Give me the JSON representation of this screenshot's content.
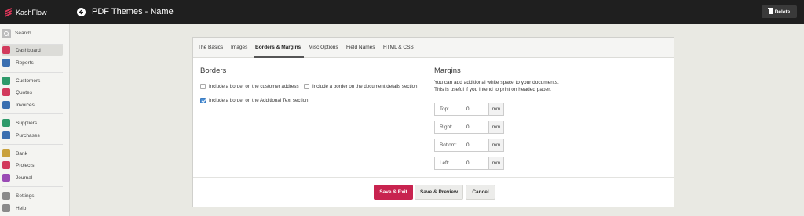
{
  "app": {
    "name": "KashFlow"
  },
  "header": {
    "title": "PDF Themes - Name",
    "delete_label": "Delete"
  },
  "sidebar": {
    "search_placeholder": "Search...",
    "items": [
      {
        "label": "Dashboard",
        "icon": "dashboard-icon",
        "color": "#d23a5c"
      },
      {
        "label": "Reports",
        "icon": "reports-icon",
        "color": "#3a6fb0"
      },
      {
        "label": "Customers",
        "icon": "customers-icon",
        "color": "#2e9a6a"
      },
      {
        "label": "Quotes",
        "icon": "quotes-icon",
        "color": "#d23a5c"
      },
      {
        "label": "Invoices",
        "icon": "invoices-icon",
        "color": "#3a6fb0"
      },
      {
        "label": "Suppliers",
        "icon": "suppliers-icon",
        "color": "#2e9a6a"
      },
      {
        "label": "Purchases",
        "icon": "purchases-icon",
        "color": "#3a6fb0"
      },
      {
        "label": "Bank",
        "icon": "bank-icon",
        "color": "#c9a13c"
      },
      {
        "label": "Projects",
        "icon": "projects-icon",
        "color": "#d23a5c"
      },
      {
        "label": "Journal",
        "icon": "journal-icon",
        "color": "#9a4bb5"
      },
      {
        "label": "Settings",
        "icon": "settings-icon",
        "color": "#8a8a8a"
      },
      {
        "label": "Help",
        "icon": "help-icon",
        "color": "#8a8a8a"
      }
    ]
  },
  "tabs": [
    "The Basics",
    "Images",
    "Borders & Margins",
    "Misc Options",
    "Field Names",
    "HTML & CSS"
  ],
  "borders": {
    "heading": "Borders",
    "opt_customer": "Include a border on the customer address",
    "opt_document": "Include a border on the document details section",
    "opt_additional": "Include a border on the Additional Text section"
  },
  "margins": {
    "heading": "Margins",
    "desc1": "You can add additional white space to your documents.",
    "desc2": "This is useful if you intend to print on headed paper.",
    "fields": [
      {
        "label": "Top:",
        "value": "0",
        "unit": "mm"
      },
      {
        "label": "Right:",
        "value": "0",
        "unit": "mm"
      },
      {
        "label": "Bottom:",
        "value": "0",
        "unit": "mm"
      },
      {
        "label": "Left:",
        "value": "0",
        "unit": "mm"
      }
    ]
  },
  "buttons": {
    "save_exit": "Save & Exit",
    "save_preview": "Save & Preview",
    "cancel": "Cancel"
  },
  "colors": {
    "accent": "#c8234f",
    "topbar": "#1f1f1f",
    "checkbox": "#4a8fd6"
  }
}
